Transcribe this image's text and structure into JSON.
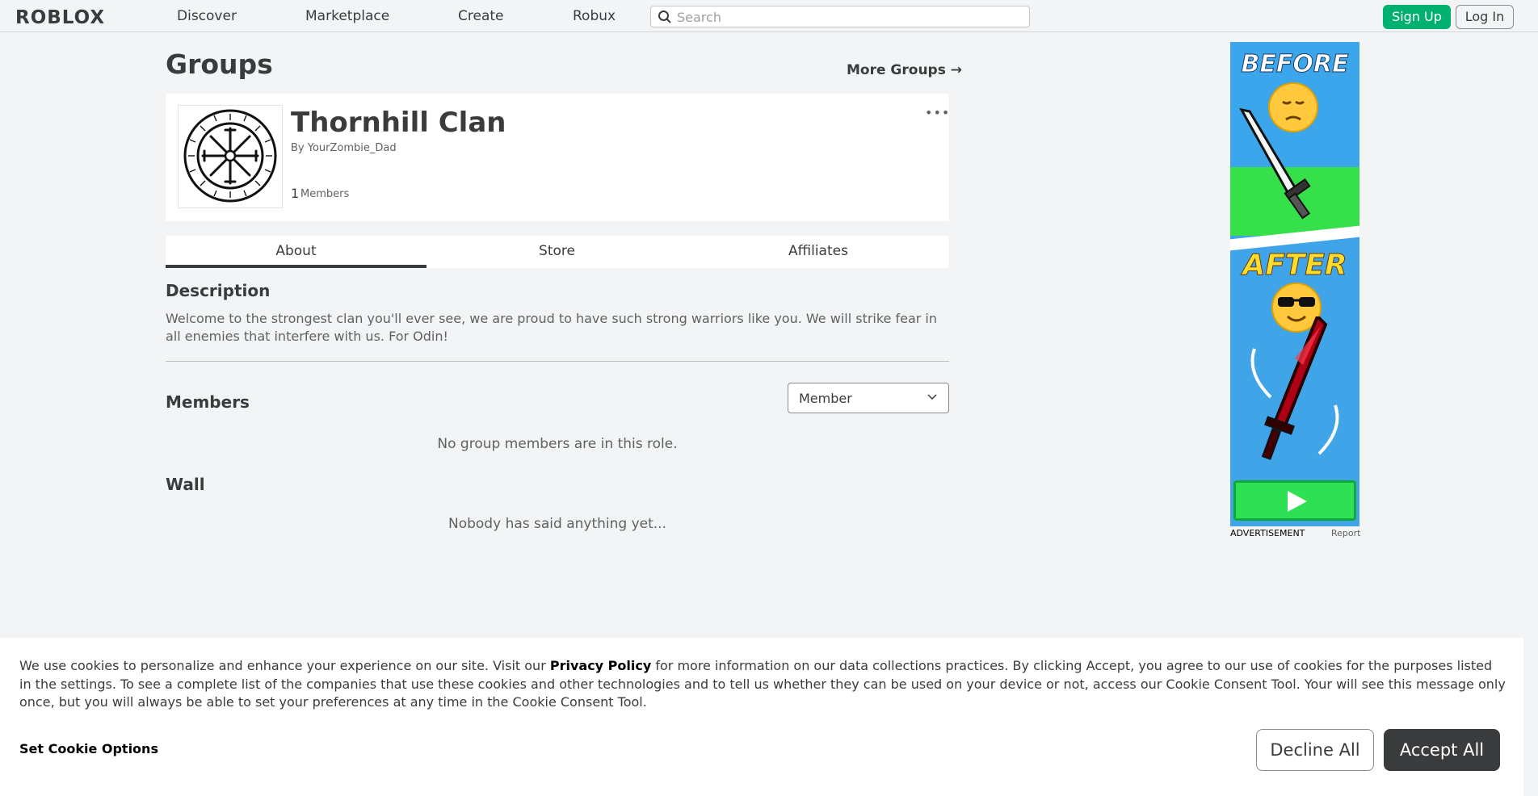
{
  "header": {
    "logo": "ROBLOX",
    "nav": [
      "Discover",
      "Marketplace",
      "Create",
      "Robux"
    ],
    "search_placeholder": "Search",
    "signup_label": "Sign Up",
    "login_label": "Log In"
  },
  "page": {
    "title": "Groups",
    "more_groups": "More Groups"
  },
  "group": {
    "name": "Thornhill Clan",
    "by_prefix": "By",
    "owner": "YourZombie_Dad",
    "member_count": "1",
    "members_label": "Members",
    "more_menu": "•••"
  },
  "tabs": [
    {
      "label": "About",
      "active": true
    },
    {
      "label": "Store",
      "active": false
    },
    {
      "label": "Affiliates",
      "active": false
    }
  ],
  "about": {
    "description_heading": "Description",
    "description": "Welcome to the strongest clan you'll ever see, we are proud to have such strong warriors like you. We will strike fear in all enemies that interfere with us. For Odin!",
    "members_heading": "Members",
    "role_selected": "Member",
    "no_members": "No group members are in this role.",
    "wall_heading": "Wall",
    "wall_empty": "Nobody has said anything yet..."
  },
  "ad": {
    "before": "BEFORE",
    "after": "AFTER",
    "label": "ADVERTISEMENT",
    "report": "Report"
  },
  "cookie": {
    "text_1": "We use cookies to personalize and enhance your experience on our site. Visit our ",
    "privacy_link": "Privacy Policy",
    "text_2": " for more information on our data collections practices. By clicking Accept, you agree to our use of cookies for the purposes listed in the settings. To see a complete list of the companies that use these cookies and other technologies and to tell us whether they can be used on your device or not, access our Cookie Consent Tool. Your will see this message only once, but you will always be able to set your preferences at any time in the Cookie Consent Tool.",
    "set_options": "Set Cookie Options",
    "decline": "Decline All",
    "accept": "Accept All"
  },
  "colors": {
    "signup_green": "#00b06f",
    "text_dark": "#393b3d",
    "accept_bg": "#393b3d"
  }
}
